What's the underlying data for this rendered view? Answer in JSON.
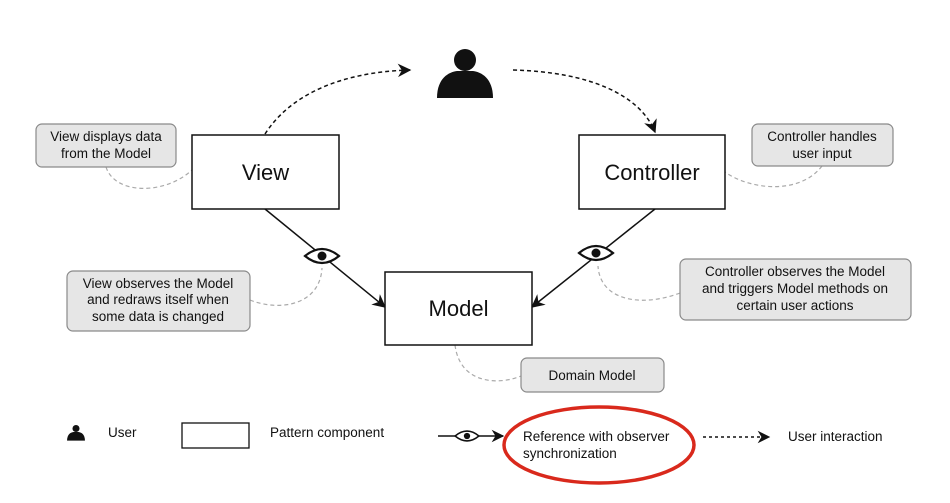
{
  "components": {
    "view": "View",
    "controller": "Controller",
    "model": "Model"
  },
  "notes": {
    "view_displays": [
      "View displays data",
      "from the Model"
    ],
    "controller_handles": [
      "Controller handles",
      "user input"
    ],
    "view_observes": [
      "View observes the Model",
      "and redraws itself when",
      "some data is changed"
    ],
    "controller_observes": [
      "Controller observes the Model",
      "and triggers Model methods on",
      "certain user actions"
    ],
    "domain_model": "Domain Model"
  },
  "legend": {
    "user": "User",
    "pattern_component": "Pattern component",
    "observer_reference": [
      "Reference with observer",
      "synchronization"
    ],
    "user_interaction": "User interaction"
  },
  "icons": [
    "user-icon",
    "eye-icon"
  ],
  "colors": {
    "highlight": "#d9291c",
    "note_fill": "#e6e6e6"
  }
}
